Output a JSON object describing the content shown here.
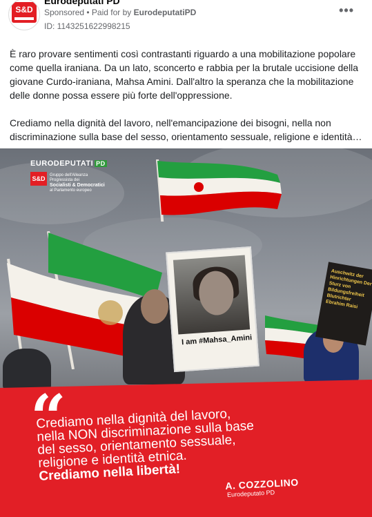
{
  "ad": {
    "avatar_text": "S&D",
    "page_name": "Eurodeputati PD",
    "sponsored": "Sponsored",
    "paid_for_prefix": "Paid for by",
    "paid_for_by": "EurodeputatiPD",
    "library_id": "ID: 1143251622998215",
    "more_icon": "•••",
    "text_paragraphs": [
      "È raro provare sentimenti così contrastanti riguardo a una mobilitazione popolare come quella iraniana. Da un lato, sconcerto e rabbia per la brutale uccisione della giovane Curdo-iraniana, Mahsa Amini. Dall'altro la speranza che la mobilitazione delle donne possa essere più forte dell'oppressione.",
      "Crediamo nella dignità del lavoro, nell'emancipazione dei bisogni, nella non discriminazione sulla base del sesso, orientamento sessuale, religione e identità…"
    ]
  },
  "creative": {
    "logo_eurodeputati": "EURODEPUTATI",
    "logo_pd": "PD",
    "logo_sd": "S&D",
    "logo_sd_text_1": "Gruppo dell'Alleanza Progressista dei",
    "logo_sd_text_2": "Socialisti & Democratici",
    "logo_sd_text_3": "al Parlamento europeo",
    "sign_caption": "I am #Mahsa_Amini",
    "black_sign_text": "Auschwitz der Hinrichtungen Der Sturz von Bildungsfreiheit Blutrichter Ebrahim Raisi",
    "quote_mark": "“",
    "quote_lines": [
      "Crediamo nella dignità del lavoro,",
      "nella NON discriminazione sulla base",
      "del sesso, orientamento sessuale,",
      "religione e identità etnica."
    ],
    "quote_emphasis": "Crediamo nella libertà!",
    "author_name": "A. COZZOLINO",
    "author_role": "Eurodeputato PD"
  },
  "colors": {
    "brand_red": "#e21f26",
    "flag_green": "#239f40",
    "flag_red": "#da0000"
  }
}
